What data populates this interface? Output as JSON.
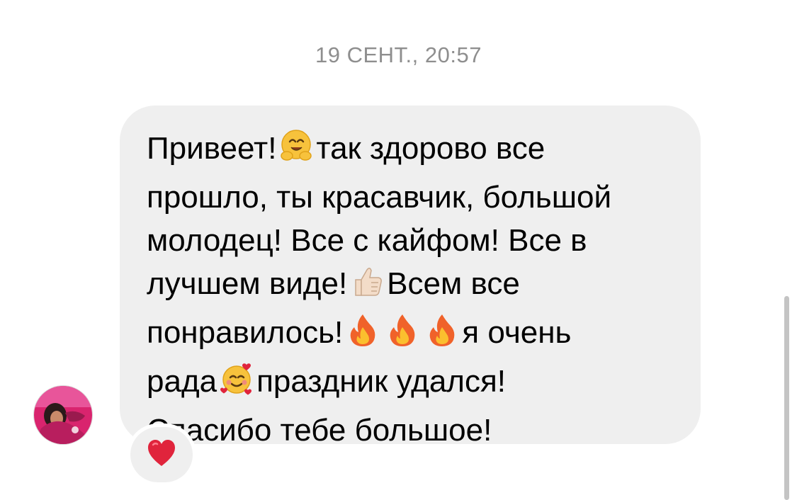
{
  "timestamp": "19 СЕНТ., 20:57",
  "message": {
    "lines": [
      [
        "Привеет!",
        "hugging-face-emoji",
        "так здорово все"
      ],
      [
        "прошло, ты красавчик, большой"
      ],
      [
        "молодец! Все с кайфом! Все в"
      ],
      [
        "лучшем виде!",
        "thumbs-up-emoji",
        "Всем все"
      ],
      [
        "понравилось!",
        "fire-emoji",
        "fire-emoji",
        "fire-emoji",
        "я очень"
      ],
      [
        "рада",
        "smiling-face-with-hearts-emoji",
        "праздник удался!"
      ],
      [
        "Спасибо тебе большое!"
      ]
    ],
    "text": {
      "l1a": "Привеет!",
      "l1b": "так здорово все",
      "l2": "прошло, ты красавчик, большой",
      "l3": "молодец! Все с кайфом! Все в",
      "l4a": "лучшем виде!",
      "l4b": "Всем все",
      "l5a": "понравилось!",
      "l5b": "я очень",
      "l6a": "рада",
      "l6b": "праздник удался!",
      "l7": "Спасибо тебе большое!"
    }
  },
  "reaction": {
    "icon": "red-heart-emoji"
  },
  "avatar": {
    "icon": "user-avatar-photo"
  },
  "colors": {
    "bubble_background": "#efefef",
    "timestamp_text": "#8e8e8e",
    "message_text": "#000000",
    "heart": "#e0243c",
    "fire": "#f0622a",
    "avatar_pink": "#d9246e"
  }
}
